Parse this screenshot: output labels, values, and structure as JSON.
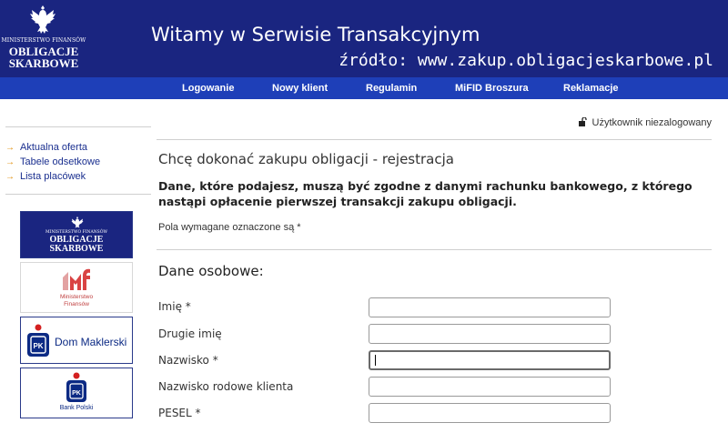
{
  "header": {
    "logo": {
      "ministry": "MINISTERSTWO FINANSÓW",
      "brand_line1": "OBLIGACJE",
      "brand_line2": "SKARBOWE"
    },
    "welcome": "Witamy w Serwisie Transakcyjnym",
    "source": "źródło: www.zakup.obligacjeskarbowe.pl",
    "colors": {
      "header_bg": "#1a2580",
      "nav_bg": "#1e3fb8",
      "accent_arrow": "#e08a00"
    }
  },
  "nav": {
    "items": [
      {
        "label": "Logowanie"
      },
      {
        "label": "Nowy klient"
      },
      {
        "label": "Regulamin"
      },
      {
        "label": "MiFID Broszura"
      },
      {
        "label": "Reklamacje"
      }
    ]
  },
  "sidebar": {
    "links": [
      {
        "label": "Aktualna oferta",
        "icon": "arrow-right-icon"
      },
      {
        "label": "Tabele odsetkowe",
        "icon": "arrow-right-icon"
      },
      {
        "label": "Lista placówek",
        "icon": "arrow-right-icon"
      }
    ],
    "banners": {
      "obligacje": {
        "ministry": "MINISTERSTWO FINANSÓW",
        "line1": "OBLIGACJE",
        "line2": "SKARBOWE"
      },
      "ministerstwo": {
        "line1": "Ministerstwo",
        "line2": "Finansów"
      },
      "dom_maklerski": {
        "label": "Dom Maklerski"
      },
      "bank_polski": {
        "label": "Bank Polski"
      }
    }
  },
  "main": {
    "user_status": "Użytkownik niezalogowany",
    "title": "Chcę dokonać zakupu obligacji - rejestracja",
    "notice": "Dane, które podajesz, muszą być zgodne z danymi rachunku bankowego, z którego nastąpi opłacenie pierwszej transakcji zakupu obligacji.",
    "required_note": "Pola wymagane oznaczone są *",
    "section": "Dane osobowe:",
    "fields": [
      {
        "label": "Imię *",
        "value": ""
      },
      {
        "label": "Drugie imię",
        "value": ""
      },
      {
        "label": "Nazwisko *",
        "value": ""
      },
      {
        "label": "Nazwisko rodowe klienta",
        "value": ""
      },
      {
        "label": "PESEL *",
        "value": ""
      }
    ]
  }
}
